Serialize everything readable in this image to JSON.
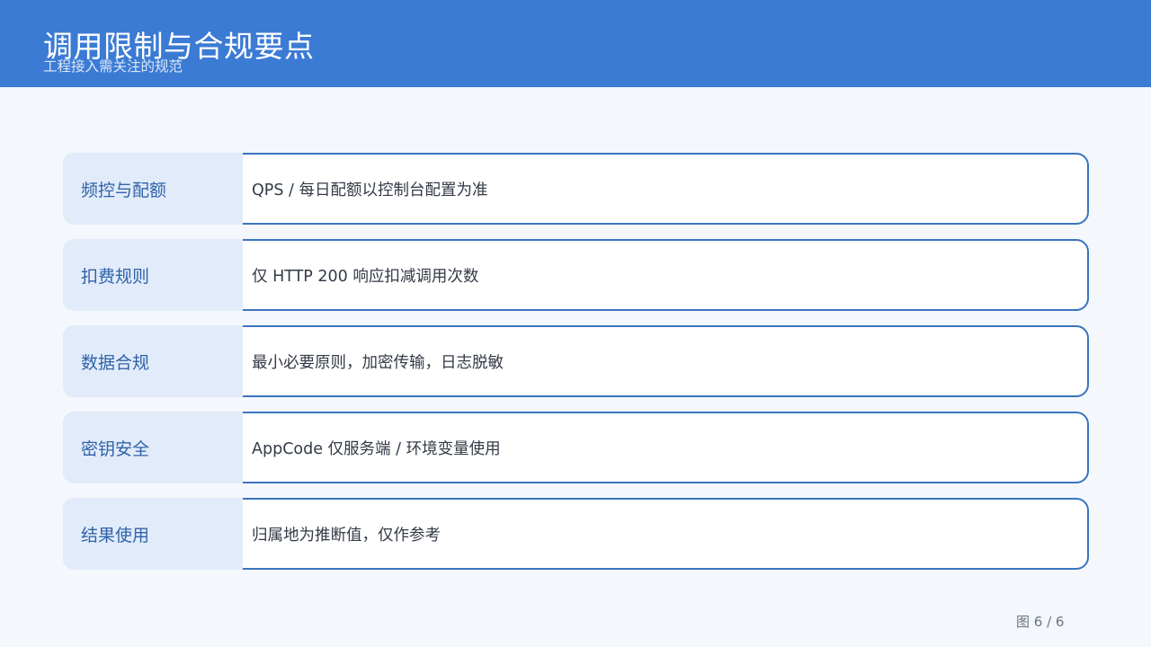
{
  "header": {
    "title": "调用限制与合规要点",
    "subtitle": "工程接入需关注的规范"
  },
  "rows": [
    {
      "label": "频控与配额",
      "value": "QPS / 每日配额以控制台配置为准"
    },
    {
      "label": "扣费规则",
      "value": "仅 HTTP 200 响应扣减调用次数"
    },
    {
      "label": "数据合规",
      "value": "最小必要原则，加密传输，日志脱敏"
    },
    {
      "label": "密钥安全",
      "value": "AppCode 仅服务端 / 环境变量使用"
    },
    {
      "label": "结果使用",
      "value": "归属地为推断值，仅作参考"
    }
  ],
  "footer": {
    "page_number": "图 6 / 6"
  },
  "colors": {
    "header_background": "#3b7bd4",
    "label_background": "#e2ebfa",
    "label_text": "#2f63a8",
    "card_border": "#3a74bf"
  }
}
